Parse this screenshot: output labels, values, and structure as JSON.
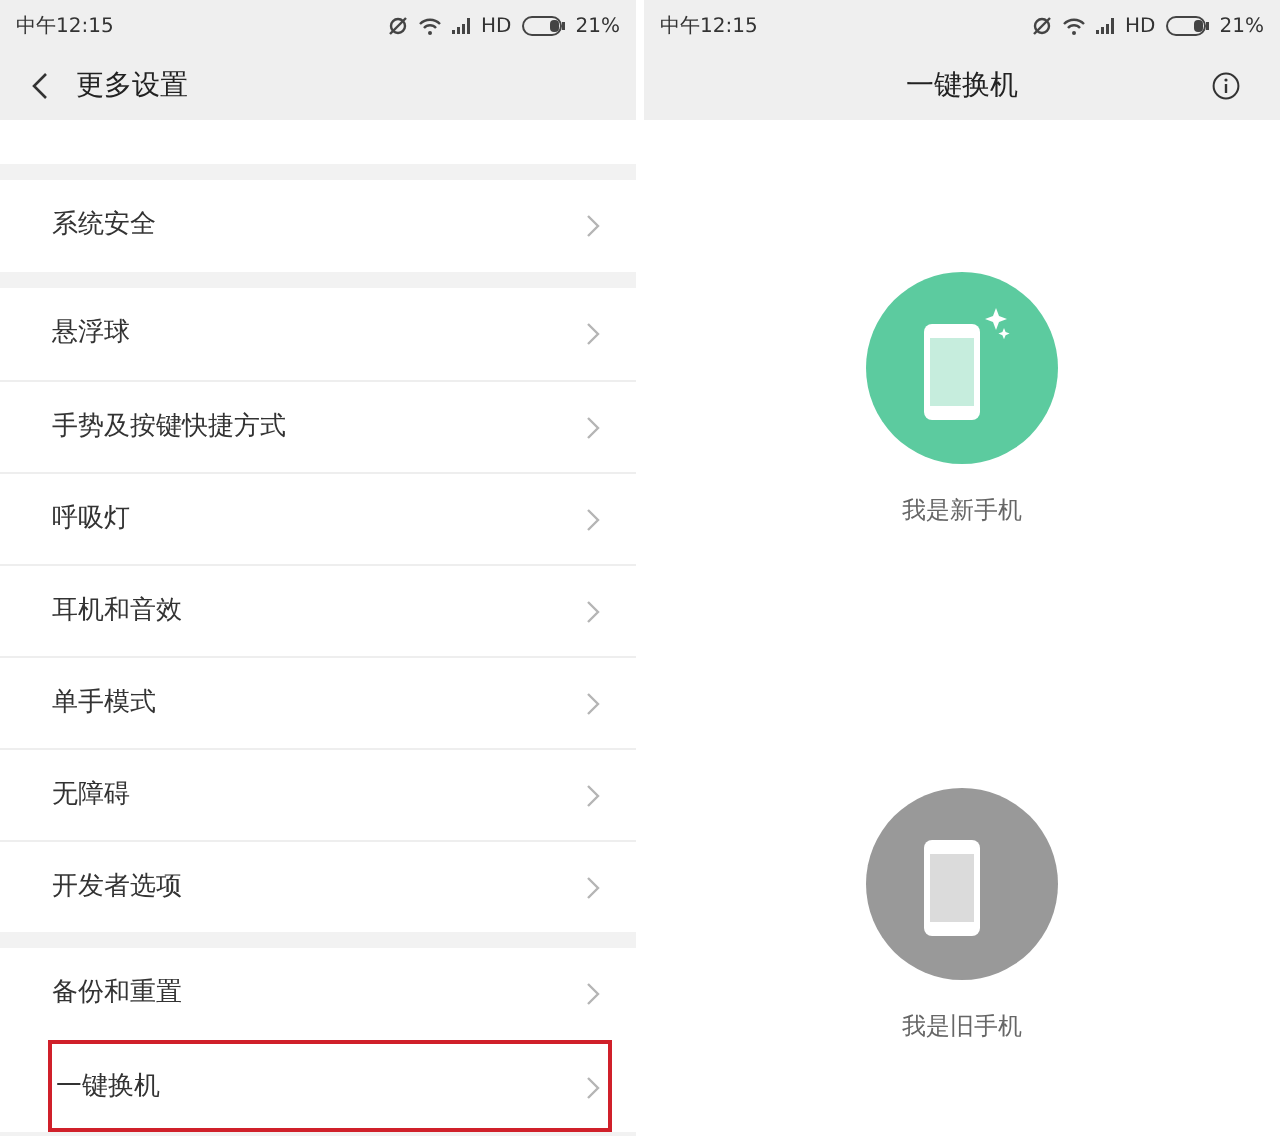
{
  "left_screen": {
    "status_bar": {
      "time": "中午12:15",
      "network": "HD",
      "battery": "21%"
    },
    "header": {
      "title": "更多设置"
    },
    "groups": [
      {
        "items": [
          {
            "label": "系统安全",
            "highlighted": false
          }
        ]
      },
      {
        "items": [
          {
            "label": "悬浮球",
            "highlighted": false
          },
          {
            "label": "手势及按键快捷方式",
            "highlighted": false
          },
          {
            "label": "呼吸灯",
            "highlighted": false
          },
          {
            "label": "耳机和音效",
            "highlighted": false
          },
          {
            "label": "单手模式",
            "highlighted": false
          },
          {
            "label": "无障碍",
            "highlighted": false
          },
          {
            "label": "开发者选项",
            "highlighted": false
          }
        ]
      },
      {
        "items": [
          {
            "label": "备份和重置",
            "highlighted": false
          },
          {
            "label": "一键换机",
            "highlighted": true
          }
        ]
      }
    ]
  },
  "right_screen": {
    "status_bar": {
      "time": "中午12:15",
      "network": "HD",
      "battery": "21%"
    },
    "header": {
      "title": "一键换机"
    },
    "options": [
      {
        "kind": "new",
        "label": "我是新手机",
        "color": "#5ccb9f"
      },
      {
        "kind": "old",
        "label": "我是旧手机",
        "color": "#999999"
      }
    ]
  }
}
